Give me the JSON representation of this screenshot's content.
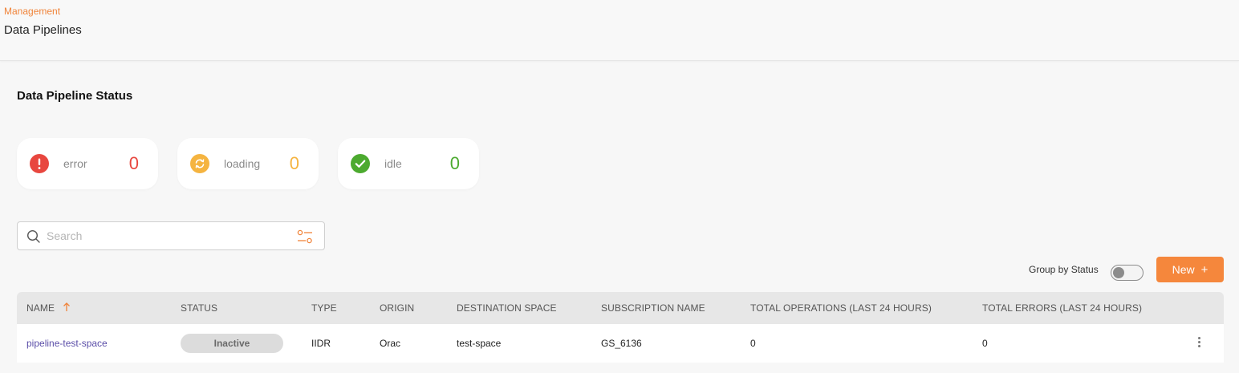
{
  "header": {
    "breadcrumb": "Management",
    "title": "Data Pipelines"
  },
  "status_section": {
    "title": "Data Pipeline Status",
    "cards": [
      {
        "label": "error",
        "count": "0",
        "color": "#e8473f",
        "icon": "exclamation-icon"
      },
      {
        "label": "loading",
        "count": "0",
        "color": "#f5b440",
        "icon": "refresh-icon"
      },
      {
        "label": "idle",
        "count": "0",
        "color": "#4caa2f",
        "icon": "check-icon"
      }
    ]
  },
  "search": {
    "placeholder": "Search",
    "value": ""
  },
  "toolbar": {
    "group_by_label": "Group by Status",
    "group_by_enabled": false,
    "new_label": "New",
    "new_icon": "+",
    "accent": "#f5873c"
  },
  "table": {
    "columns": [
      "NAME",
      "STATUS",
      "TYPE",
      "ORIGIN",
      "DESTINATION SPACE",
      "SUBSCRIPTION NAME",
      "TOTAL OPERATIONS (LAST 24 HOURS)",
      "TOTAL ERRORS (LAST 24 HOURS)"
    ],
    "sort": {
      "column": "NAME",
      "direction": "ascending"
    },
    "rows": [
      {
        "name": "pipeline-test-space",
        "status": "Inactive",
        "type": "IIDR",
        "origin": "Orac",
        "destination": "test-space",
        "subscription": "GS_6136",
        "total_operations": "0",
        "total_errors": "0"
      }
    ]
  }
}
